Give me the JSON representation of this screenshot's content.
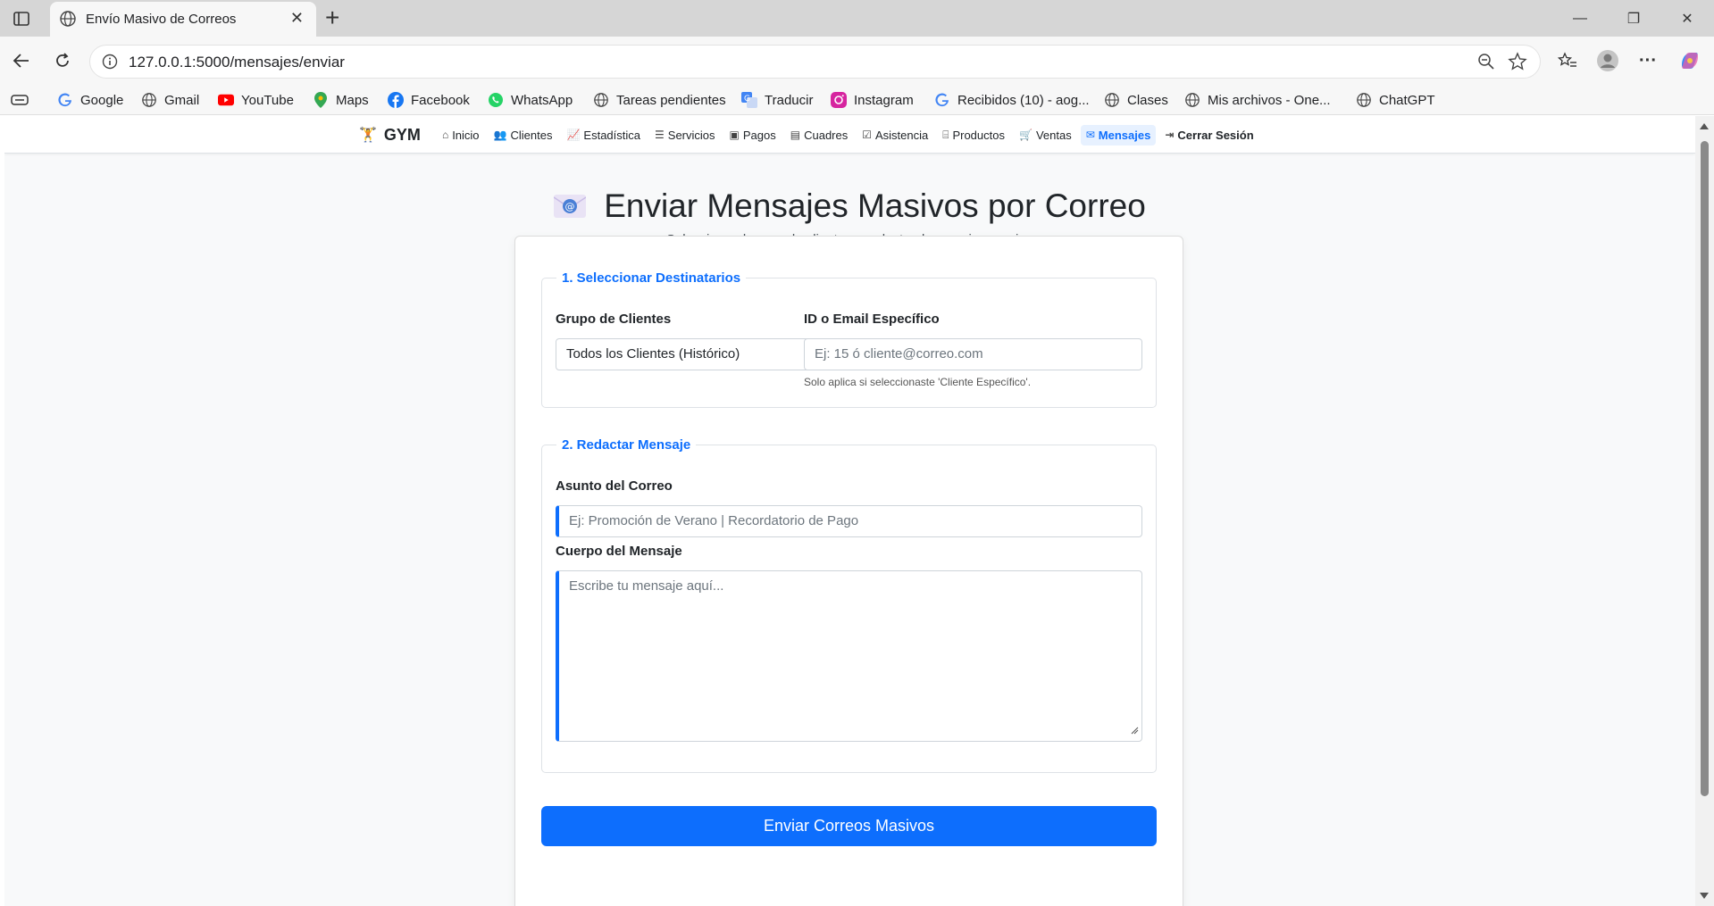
{
  "browser": {
    "tab_title": "Envío Masivo de Correos",
    "url": "127.0.0.1:5000/mensajes/enviar",
    "bookmarks": [
      {
        "label": "Google",
        "icon": "google-icon"
      },
      {
        "label": "Gmail",
        "icon": "globe-icon"
      },
      {
        "label": "YouTube",
        "icon": "youtube-icon"
      },
      {
        "label": "Maps",
        "icon": "maps-pin-icon"
      },
      {
        "label": "Facebook",
        "icon": "facebook-icon"
      },
      {
        "label": "WhatsApp",
        "icon": "whatsapp-icon"
      },
      {
        "label": "Tareas pendientes",
        "icon": "globe-icon"
      },
      {
        "label": "Traducir",
        "icon": "translate-icon"
      },
      {
        "label": "Instagram",
        "icon": "instagram-icon"
      },
      {
        "label": "Recibidos (10) - aog...",
        "icon": "google-icon"
      },
      {
        "label": "Clases",
        "icon": "globe-icon"
      },
      {
        "label": "Mis archivos - One...",
        "icon": "globe-icon"
      },
      {
        "label": "ChatGPT",
        "icon": "globe-icon"
      }
    ]
  },
  "nav": {
    "brand": "GYM",
    "items": [
      {
        "label": "Inicio",
        "icon": "home-icon"
      },
      {
        "label": "Clientes",
        "icon": "users-icon"
      },
      {
        "label": "Estadística",
        "icon": "chart-icon"
      },
      {
        "label": "Servicios",
        "icon": "list-icon"
      },
      {
        "label": "Pagos",
        "icon": "wallet-icon"
      },
      {
        "label": "Cuadres",
        "icon": "cash-register-icon"
      },
      {
        "label": "Asistencia",
        "icon": "calendar-check-icon"
      },
      {
        "label": "Productos",
        "icon": "basket-icon"
      },
      {
        "label": "Ventas",
        "icon": "cart-icon"
      },
      {
        "label": "Mensajes",
        "icon": "envelope-icon",
        "active": true
      },
      {
        "label": "Cerrar Sesión",
        "icon": "logout-icon"
      }
    ]
  },
  "page": {
    "title": "Enviar Mensajes Masivos por Correo",
    "subtitle": "Selecciona el grupo de clientes y redacta el mensaje a enviar."
  },
  "form": {
    "section1": {
      "legend": "1. Seleccionar Destinatarios",
      "group_label": "Grupo de Clientes",
      "group_value": "Todos los Clientes (Histórico)",
      "id_label": "ID o Email Específico",
      "id_placeholder": "Ej: 15 ó cliente@correo.com",
      "id_help": "Solo aplica si seleccionaste 'Cliente Específico'."
    },
    "section2": {
      "legend": "2. Redactar Mensaje",
      "subject_label": "Asunto del Correo",
      "subject_placeholder": "Ej: Promoción de Verano | Recordatorio de Pago",
      "body_label": "Cuerpo del Mensaje",
      "body_placeholder": "Escribe tu mensaje aquí..."
    },
    "submit_label": "Enviar Correos Masivos"
  },
  "colors": {
    "primary": "#0d6efd",
    "active_nav_bg": "#e7f1ff"
  }
}
